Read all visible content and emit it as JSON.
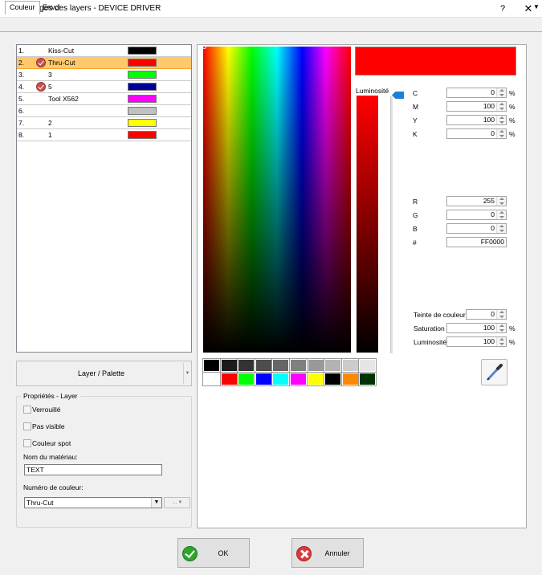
{
  "window": {
    "title": "Réglages des layers - DEVICE DRIVER",
    "help_label": "?",
    "close_label": "✕"
  },
  "tabs": [
    {
      "label": "Couleur",
      "active": true
    },
    {
      "label": "Envoi",
      "active": false
    }
  ],
  "layers": [
    {
      "num": "1.",
      "name": "Kiss-Cut",
      "checked": false,
      "color": "#000000"
    },
    {
      "num": "2.",
      "name": "Thru-Cut",
      "checked": true,
      "color": "#ff0000",
      "selected": true
    },
    {
      "num": "3.",
      "name": "3",
      "checked": false,
      "color": "#00ff00"
    },
    {
      "num": "4.",
      "name": "5",
      "checked": true,
      "color": "#000099"
    },
    {
      "num": "5.",
      "name": "Tool X562",
      "checked": false,
      "color": "#ff00ff"
    },
    {
      "num": "6.",
      "name": "",
      "checked": false,
      "color": "#c0c0c0"
    },
    {
      "num": "7.",
      "name": "2",
      "checked": false,
      "color": "#ffff00"
    },
    {
      "num": "8.",
      "name": "1",
      "checked": false,
      "color": "#ff0000"
    }
  ],
  "layer_palette_button": "Layer / Palette",
  "properties": {
    "legend": "Propriétés - Layer",
    "locked": "Verrouillé",
    "not_visible": "Pas visible",
    "spot_color": "Couleur spot",
    "material_label": "Nom du matériau:",
    "material_value": "TEXT",
    "color_number_label": "Numéro de couleur:",
    "color_number_value": "Thru-Cut",
    "extra_button": "... ▾"
  },
  "color": {
    "preview": "#ff0000",
    "luminosity_label": "Luminosité",
    "cmyk": [
      {
        "label": "C",
        "value": "0",
        "unit": "%"
      },
      {
        "label": "M",
        "value": "100",
        "unit": "%"
      },
      {
        "label": "Y",
        "value": "100",
        "unit": "%"
      },
      {
        "label": "K",
        "value": "0",
        "unit": "%"
      }
    ],
    "rgb": [
      {
        "label": "R",
        "value": "255"
      },
      {
        "label": "G",
        "value": "0"
      },
      {
        "label": "B",
        "value": "0"
      }
    ],
    "hex_label": "#",
    "hex_value": "FF0000",
    "hsl": [
      {
        "label": "Teinte de couleur",
        "value": "0",
        "unit": ""
      },
      {
        "label": "Saturation",
        "value": "100",
        "unit": "%"
      },
      {
        "label": "Luminosité",
        "value": "100",
        "unit": "%"
      }
    ]
  },
  "palette": {
    "row1": [
      "#000000",
      "#1c1c1c",
      "#333333",
      "#4d4d4d",
      "#666666",
      "#808080",
      "#999999",
      "#b3b3b3",
      "#cccccc",
      "#e6e6e6"
    ],
    "row2": [
      "#ffffff",
      "#ff0000",
      "#00ff00",
      "#0000ff",
      "#00ffff",
      "#ff00ff",
      "#ffff00",
      "#000000",
      "#ff8800",
      "#003300"
    ]
  },
  "buttons": {
    "ok": "OK",
    "cancel": "Annuler"
  }
}
